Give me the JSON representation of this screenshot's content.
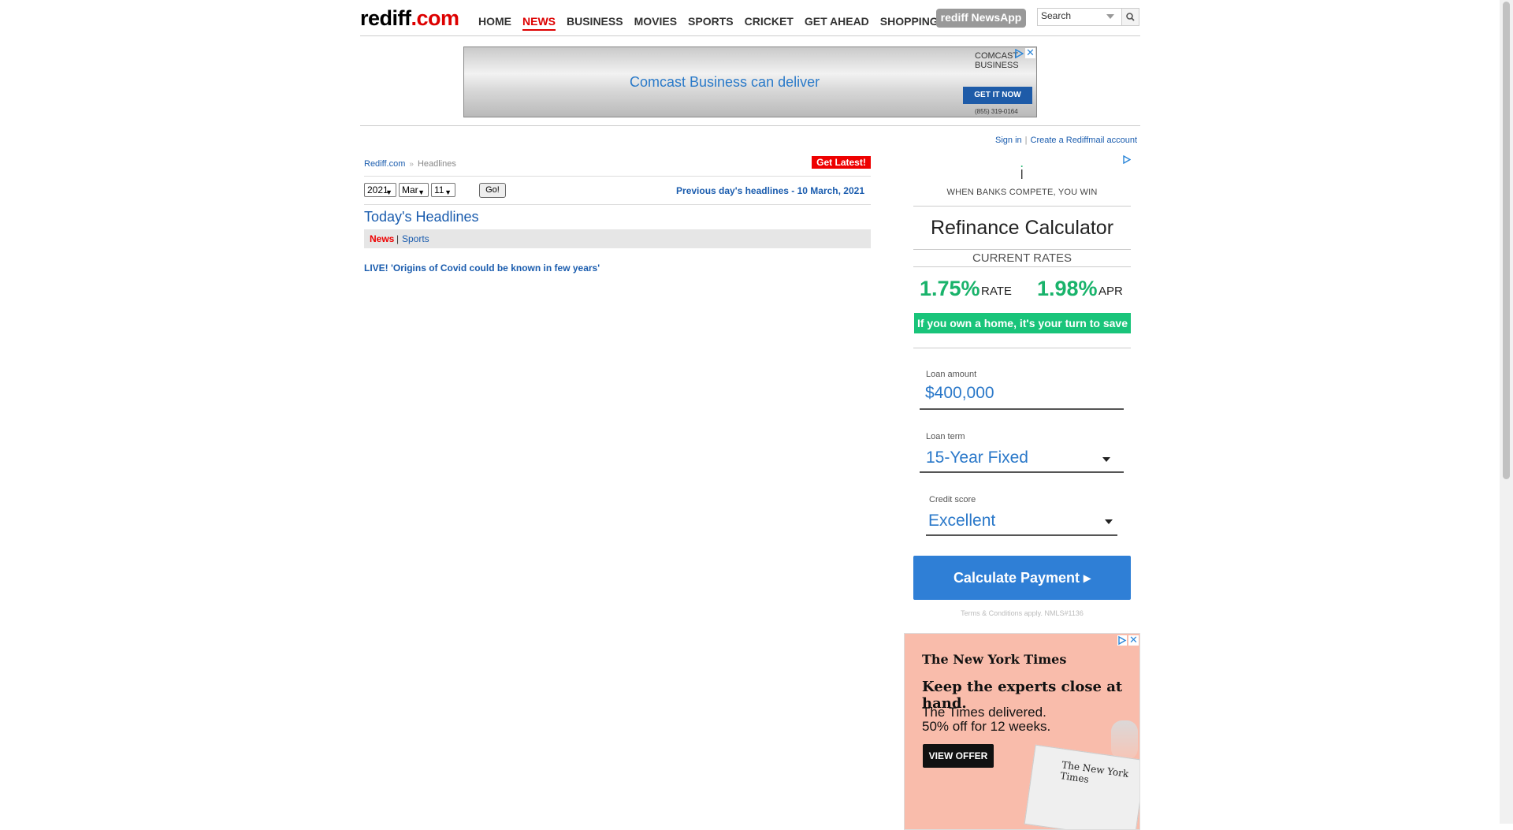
{
  "header": {
    "logo": "rediff.com",
    "nav": [
      "HOME",
      "NEWS",
      "BUSINESS",
      "MOVIES",
      "SPORTS",
      "CRICKET",
      "GET AHEAD",
      "SHOPPING"
    ],
    "active_nav": "NEWS",
    "newsapp_label": "rediff NewsApp",
    "search_value": "Search"
  },
  "top_ad": {
    "text": "Comcast Business can deliver",
    "brand_line1": "COMCAST",
    "brand_line2": "BUSINESS",
    "cta": "GET IT NOW",
    "phone": "(855) 319-0164"
  },
  "account": {
    "signin": "Sign in",
    "create": "Create a Rediffmail account",
    "separator": "|"
  },
  "main": {
    "breadcrumb_home": "Rediff.com",
    "breadcrumb_arrow": "»",
    "breadcrumb_current": "Headlines",
    "get_latest": "Get Latest!",
    "year": "2021",
    "month": "Mar",
    "day": "11",
    "go": "Go!",
    "prev_day": "Previous day's headlines - 10 March, 2021",
    "heading": "Today's Headlines",
    "tab_news": "News",
    "tab_sep": "|",
    "tab_sports": "Sports",
    "headline": "LIVE! 'Origins of Covid could be known in few years'"
  },
  "refi_ad": {
    "tagline": "WHEN BANKS COMPETE, YOU WIN",
    "title": "Refinance Calculator",
    "current_rates": "CURRENT RATES",
    "rate": "1.75%",
    "rate_label": "RATE",
    "apr": "1.98%",
    "apr_label": "APR",
    "banner": "If you own a home, it's your turn to save",
    "loan_amount_label": "Loan amount",
    "loan_amount_value": "$400,000",
    "loan_term_label": "Loan term",
    "loan_term_value": "15-Year Fixed",
    "credit_label": "Credit score",
    "credit_value": "Excellent",
    "calc_button": "Calculate Payment ▸",
    "terms": "Terms & Conditions apply. NMLS#1136"
  },
  "nyt_ad": {
    "brand": "The New York Times",
    "headline": "Keep the experts close at hand.",
    "sub1": "The Times delivered.",
    "sub2": "50% off for 12 weeks.",
    "cta": "VIEW OFFER"
  },
  "colors": {
    "brand_red": "#dd0000",
    "link_blue": "#1a5cae",
    "rate_green": "#19b36b",
    "calc_blue": "#2f7fd6",
    "nyt_bg": "#f9bcab"
  }
}
